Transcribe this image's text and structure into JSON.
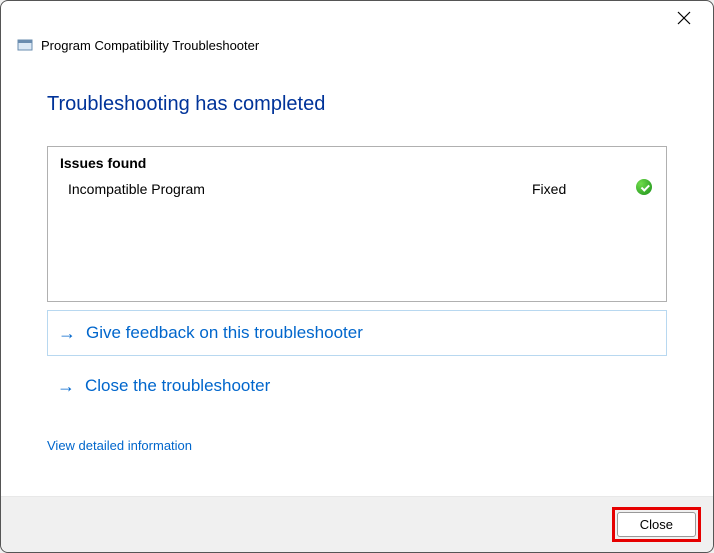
{
  "window": {
    "title": "Program Compatibility Troubleshooter"
  },
  "heading": "Troubleshooting has completed",
  "issues": {
    "header": "Issues found",
    "items": [
      {
        "name": "Incompatible Program",
        "status": "Fixed"
      }
    ]
  },
  "options": {
    "feedback": "Give feedback on this troubleshooter",
    "close": "Close the troubleshooter"
  },
  "detail_link": "View detailed information",
  "footer": {
    "close_label": "Close"
  }
}
